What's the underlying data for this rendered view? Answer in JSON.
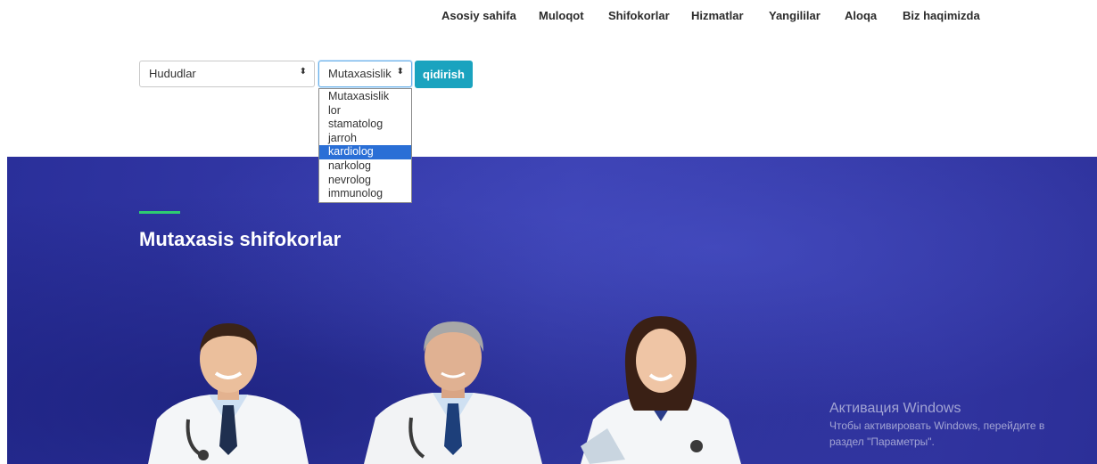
{
  "nav": {
    "items": [
      "Asosiy sahifa",
      "Muloqot",
      "Shifokorlar",
      "Hizmatlar",
      "Yangililar",
      "Aloqa",
      "Biz haqimizda"
    ]
  },
  "filters": {
    "region_select": "Hududlar",
    "specialty_select": "Mutaxasislik",
    "search_button": "qidirish",
    "specialty_options": [
      "Mutaxasislik",
      "lor",
      "stamatolog",
      "jarroh",
      "kardiolog",
      "narkolog",
      "nevrolog",
      "immunolog"
    ],
    "highlighted_option": "kardiolog"
  },
  "hero": {
    "title": "Mutaxasis shifokorlar"
  },
  "watermark": {
    "title": "Активация Windows",
    "line1": "Чтобы активировать Windows, перейдите в",
    "line2": "раздел \"Параметры\"."
  },
  "colors": {
    "accent": "#1aa3bf",
    "hero_bg": "#2f34a3",
    "highlight": "#2a6fd6",
    "hero_line": "#2ecc71"
  }
}
